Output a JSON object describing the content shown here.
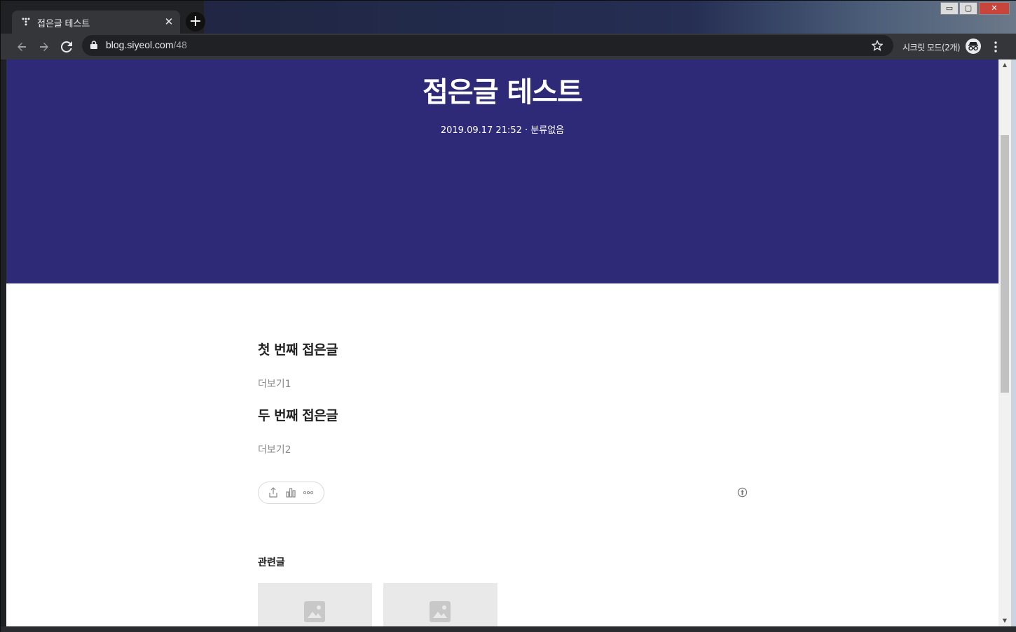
{
  "browser": {
    "tab_title": "접은글 테스트",
    "tab_close": "✕",
    "new_tab": "+",
    "url_host": "blog.siyeol.com",
    "url_path": "/48",
    "incognito_label": "시크릿 모드(2개)",
    "window_controls": {
      "minimize": "▭",
      "maximize": "▢",
      "close": "✕"
    }
  },
  "post": {
    "title": "접은글 테스트",
    "meta": "2019.09.17 21:52 · 분류없음",
    "folds": [
      {
        "title": "첫 번째 접은글",
        "more": "더보기1"
      },
      {
        "title": "두 번째 접은글",
        "more": "더보기2"
      }
    ],
    "related_title": "관련글"
  },
  "colors": {
    "hero_bg": "#2e2a77",
    "chrome_dark": "#202124",
    "chrome_toolbar": "#35363a"
  },
  "icons": [
    "favicon-icon",
    "back-icon",
    "forward-icon",
    "reload-icon",
    "lock-icon",
    "star-icon",
    "incognito-icon",
    "menu-icon",
    "share-icon",
    "stats-icon",
    "more-icon",
    "info-icon",
    "image-placeholder-icon"
  ]
}
